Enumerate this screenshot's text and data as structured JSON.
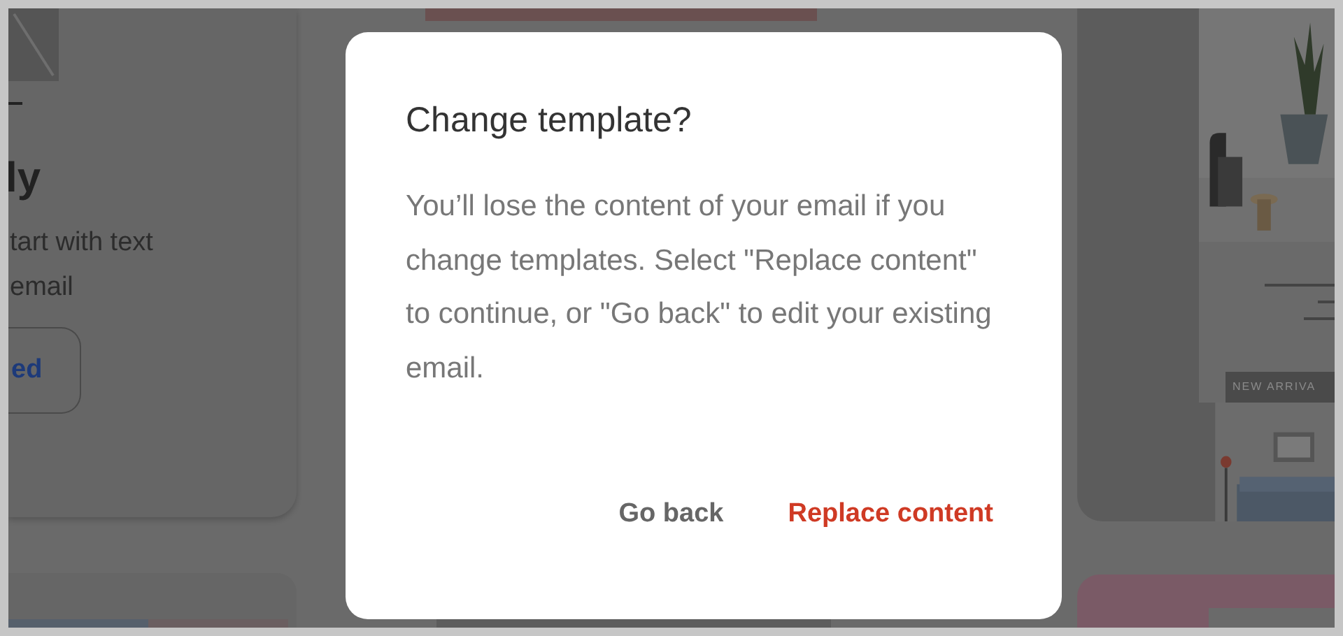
{
  "background": {
    "card": {
      "title": "ly",
      "description_lines": [
        "tart with text",
        "email"
      ],
      "button": "ed"
    },
    "template_banner": "NEW ARRIVA"
  },
  "dialog": {
    "title": "Change template?",
    "message": "You’ll lose the content of your email if you change templates. Select \"Replace content\" to continue, or \"Go back\" to edit your existing email.",
    "buttons": [
      {
        "label": "Go back",
        "kind": "secondary"
      },
      {
        "label": "Replace content",
        "kind": "primary"
      }
    ]
  }
}
